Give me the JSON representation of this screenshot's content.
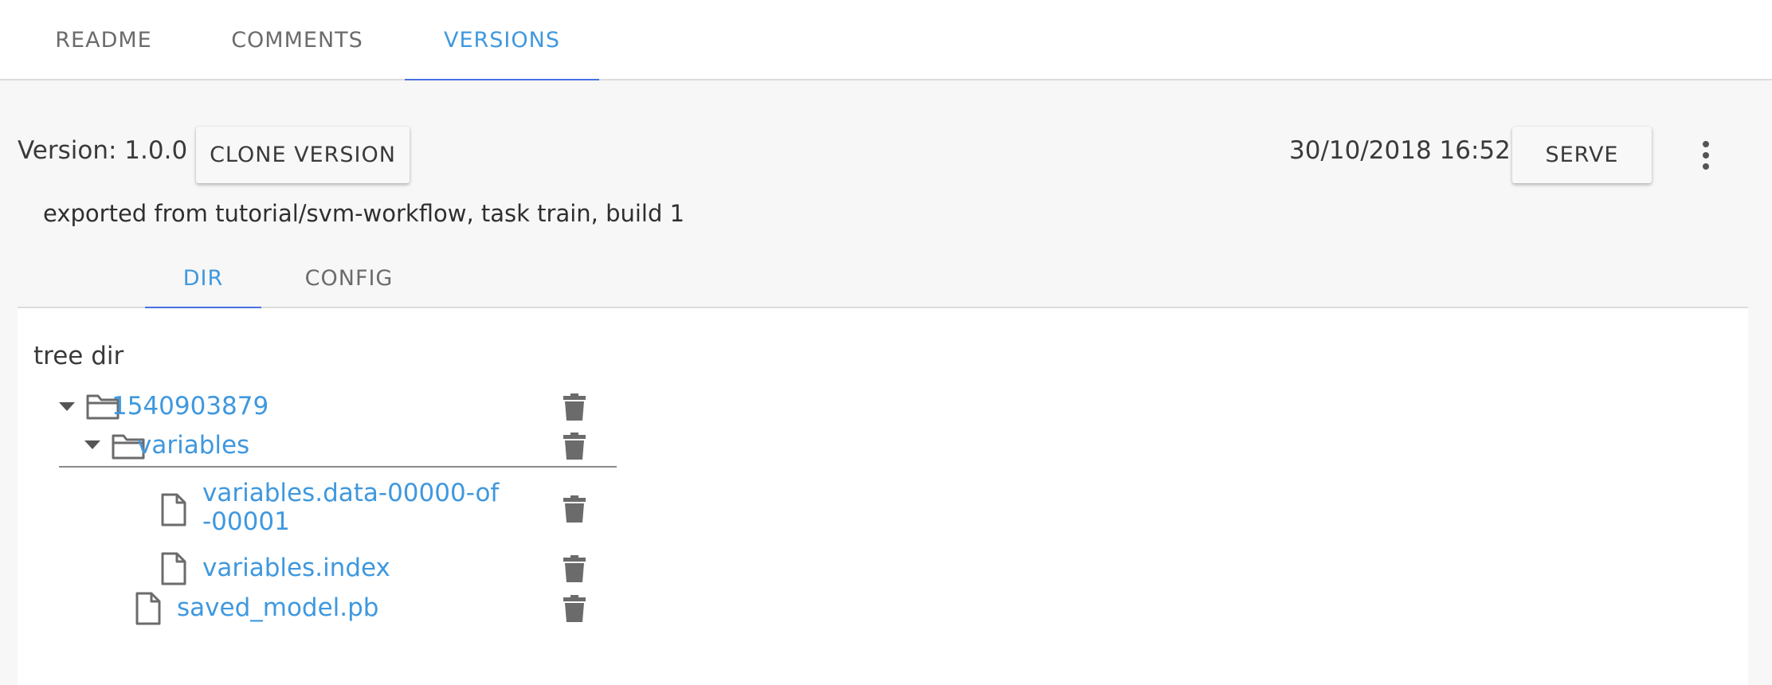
{
  "tabs": [
    {
      "label": "README",
      "active": false
    },
    {
      "label": "COMMENTS",
      "active": false
    },
    {
      "label": "VERSIONS",
      "active": true
    }
  ],
  "version": {
    "label": "Version: 1.0.0",
    "clone_button": "CLONE VERSION",
    "date": "30/10/2018 16:52",
    "serve_button": "SERVE",
    "description": "exported from tutorial/svm-workflow, task train, build 1"
  },
  "subtabs": [
    {
      "label": "DIR",
      "active": true
    },
    {
      "label": "CONFIG",
      "active": false
    }
  ],
  "tree": {
    "title": "tree dir",
    "nodes": [
      {
        "name": "1540903879",
        "type": "folder",
        "expanded": true
      },
      {
        "name": "variables",
        "type": "folder",
        "expanded": true,
        "selected": true
      },
      {
        "name": "variables.data-00000-of",
        "name_cont": "-00001",
        "type": "file"
      },
      {
        "name": "variables.index",
        "type": "file"
      },
      {
        "name": "saved_model.pb",
        "type": "file"
      }
    ]
  },
  "colors": {
    "accent": "#3f98de",
    "tab_indicator": "#4a6fe3",
    "panel_bg": "#f7f7f7",
    "icon": "#6b6b6b"
  },
  "icons": {
    "folder": "folder-icon",
    "file": "file-icon",
    "delete": "trash-icon",
    "more": "more-vert-icon",
    "expand": "caret-down-icon"
  }
}
